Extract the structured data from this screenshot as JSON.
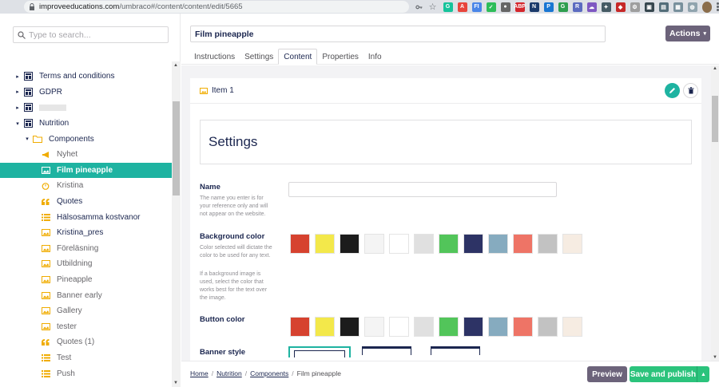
{
  "browser": {
    "url_host": "improveeducations.com",
    "url_path": "/umbraco#/content/content/edit/5665",
    "extensions": [
      {
        "name": "grammarly-ext-icon",
        "color": "#15c39a",
        "glyph": "G"
      },
      {
        "name": "acrobat-ext-icon",
        "color": "#e8453c",
        "glyph": "A"
      },
      {
        "name": "fi-ext-icon",
        "color": "#4a86e8",
        "glyph": "FI"
      },
      {
        "name": "check-ext-icon",
        "color": "#2ebd59",
        "glyph": "✓"
      },
      {
        "name": "ext-dot-icon",
        "color": "#666666",
        "glyph": "●"
      },
      {
        "name": "abp-ext-icon",
        "color": "#d4262c",
        "glyph": "ABP"
      },
      {
        "name": "ext-n-icon",
        "color": "#1b3a6b",
        "glyph": "N"
      },
      {
        "name": "ext-p-icon",
        "color": "#1976d2",
        "glyph": "P"
      },
      {
        "name": "ext-g-icon",
        "color": "#2e9e4f",
        "glyph": "G"
      },
      {
        "name": "ext-r-icon",
        "color": "#5c6bc0",
        "glyph": "R"
      },
      {
        "name": "ext-cloud-icon",
        "color": "#7e57c2",
        "glyph": "☁"
      },
      {
        "name": "ext-bird-icon",
        "color": "#455a64",
        "glyph": "✦"
      },
      {
        "name": "ext-red-icon",
        "color": "#c62828",
        "glyph": "◆"
      },
      {
        "name": "ext-gear-icon",
        "color": "#9e9e9e",
        "glyph": "⚙"
      },
      {
        "name": "ext-screen-icon",
        "color": "#37474f",
        "glyph": "▣"
      },
      {
        "name": "ext-doc-icon",
        "color": "#546e7a",
        "glyph": "▤"
      },
      {
        "name": "ext-calendar-icon",
        "color": "#78909c",
        "glyph": "▦"
      },
      {
        "name": "ext-globe-icon",
        "color": "#90a4ae",
        "glyph": "◍"
      }
    ]
  },
  "tree": {
    "search_placeholder": "Type to search...",
    "items": [
      {
        "label": "Terms and conditions",
        "level": 0,
        "caret": "▸",
        "icon": "layout-icon",
        "style": "root"
      },
      {
        "label": "GDPR",
        "level": 0,
        "caret": "▸",
        "icon": "layout-icon",
        "style": "root"
      },
      {
        "label": "",
        "level": 0,
        "caret": "▸",
        "icon": "layout-icon",
        "style": "root-blurred"
      },
      {
        "label": "Nutrition",
        "level": 0,
        "caret": "▾",
        "icon": "layout-icon",
        "style": "root"
      },
      {
        "label": "Components",
        "level": 1,
        "caret": "▾",
        "icon": "folder-icon",
        "style": "folder"
      },
      {
        "label": "Nyhet",
        "level": 2,
        "caret": "",
        "icon": "megaphone-icon",
        "style": "child"
      },
      {
        "label": "Film pineapple",
        "level": 2,
        "caret": "",
        "icon": "image-icon",
        "style": "selected"
      },
      {
        "label": "Kristina",
        "level": 2,
        "caret": "",
        "icon": "timer-icon",
        "style": "child"
      },
      {
        "label": "Quotes",
        "level": 2,
        "caret": "",
        "icon": "quote-icon",
        "style": "child-dark"
      },
      {
        "label": "Hälsosamma kostvanor",
        "level": 2,
        "caret": "",
        "icon": "list-icon",
        "style": "child-dark"
      },
      {
        "label": "Kristina_pres",
        "level": 2,
        "caret": "",
        "icon": "picture-icon",
        "style": "child-dark"
      },
      {
        "label": "Föreläsning",
        "level": 2,
        "caret": "",
        "icon": "picture-icon",
        "style": "child"
      },
      {
        "label": "Utbildning",
        "level": 2,
        "caret": "",
        "icon": "picture-icon",
        "style": "child"
      },
      {
        "label": "Pineapple",
        "level": 2,
        "caret": "",
        "icon": "image-icon",
        "style": "child"
      },
      {
        "label": "Banner early",
        "level": 2,
        "caret": "",
        "icon": "picture-icon",
        "style": "child"
      },
      {
        "label": "Gallery",
        "level": 2,
        "caret": "",
        "icon": "picture-icon",
        "style": "child"
      },
      {
        "label": "tester",
        "level": 2,
        "caret": "",
        "icon": "image-icon",
        "style": "child"
      },
      {
        "label": "Quotes (1)",
        "level": 2,
        "caret": "",
        "icon": "quote-icon",
        "style": "child"
      },
      {
        "label": "Test",
        "level": 2,
        "caret": "",
        "icon": "list-icon",
        "style": "child"
      },
      {
        "label": "Push",
        "level": 2,
        "caret": "",
        "icon": "list-icon",
        "style": "child"
      }
    ]
  },
  "header": {
    "name_value": "Film pineapple",
    "actions_label": "Actions",
    "tabs": [
      "Instructions",
      "Settings",
      "Content",
      "Properties",
      "Info"
    ],
    "active_tab": "Content"
  },
  "item": {
    "label": "Item 1",
    "settings_title": "Settings"
  },
  "props": {
    "name_label": "Name",
    "name_desc": "The name you enter is for your reference only and will not appear on the website.",
    "name_value": "",
    "bg_label": "Background color",
    "bg_desc1": "Color selected will dictate the color to be used for any text.",
    "bg_desc2": "If a background image is used, select the color that works best for the text over the image.",
    "button_label": "Button color",
    "banner_label": "Banner style"
  },
  "swatches": [
    "#d6422f",
    "#f3e84a",
    "#1c1c1c",
    "#f4f4f4",
    "#ffffff",
    "#e0e0e0",
    "#52c55a",
    "#2d3365",
    "#86abbf",
    "#ee7466",
    "#c2c2c2",
    "#f6ece2"
  ],
  "footer": {
    "crumbs": [
      "Home",
      "Nutrition",
      "Components"
    ],
    "current": "Film pineapple",
    "preview_label": "Preview",
    "publish_label": "Save and publish"
  },
  "colors": {
    "accent": "#1eb3a1",
    "publish": "#2bc37c",
    "secondary_button": "#6c637a",
    "icon_orange": "#f0ac00"
  }
}
